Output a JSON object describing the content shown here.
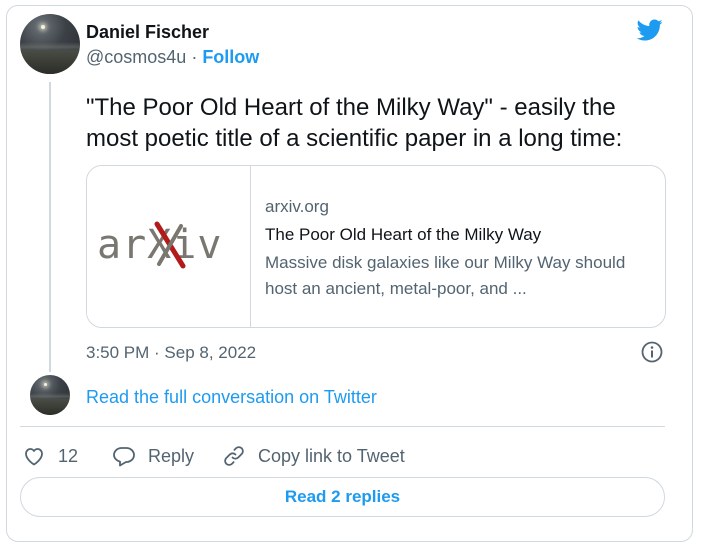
{
  "author": {
    "name": "Daniel Fischer",
    "handle": "@cosmos4u",
    "separator": " · ",
    "follow_label": "Follow"
  },
  "tweet": {
    "text": "\"The Poor Old Heart of the Milky Way\" - easily the most poetic title of a scientific paper in a long time:",
    "timestamp": "3:50 PM · Sep 8, 2022"
  },
  "link_card": {
    "thumbnail_logo_text": "arXiv",
    "domain": "arxiv.org",
    "title": "The Poor Old Heart of the Milky Way",
    "description": "Massive disk galaxies like our Milky Way should host an ancient, metal-poor, and ..."
  },
  "conversation": {
    "read_full_label": "Read the full conversation on Twitter"
  },
  "actions": {
    "like_count": "12",
    "reply_label": "Reply",
    "copy_label": "Copy link to Tweet"
  },
  "footer": {
    "read_replies_label": "Read 2 replies"
  },
  "icons": {
    "brand": "twitter-bird-icon",
    "info": "info-icon",
    "like": "heart-icon",
    "reply": "speech-bubble-icon",
    "copy": "link-icon"
  },
  "colors": {
    "accent": "#1d9bf0",
    "text_primary": "#0f1419",
    "text_secondary": "#536471",
    "border": "#cfd9de",
    "arxiv_gray": "#7a7670",
    "arxiv_red": "#b31b1b"
  }
}
